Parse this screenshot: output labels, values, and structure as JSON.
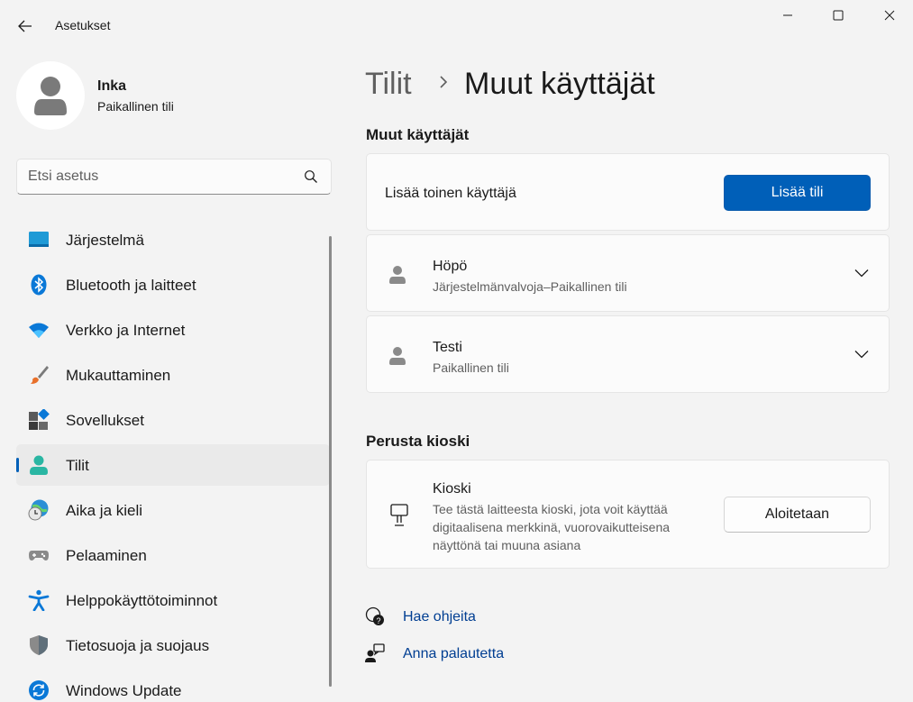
{
  "window": {
    "title": "Asetukset",
    "icons": {
      "back": "back-arrow-icon",
      "minimize": "minimize-icon",
      "maximize": "maximize-icon",
      "close": "close-icon"
    }
  },
  "user": {
    "name": "Inka",
    "account_type": "Paikallinen tili",
    "icon": "user-avatar-icon"
  },
  "search": {
    "placeholder": "Etsi asetus",
    "icon": "search-icon"
  },
  "sidebar": {
    "active_index": 5,
    "accent": "#005fb8",
    "items": [
      {
        "label": "Järjestelmä",
        "icon": "system-icon"
      },
      {
        "label": "Bluetooth ja laitteet",
        "icon": "bluetooth-icon"
      },
      {
        "label": "Verkko ja Internet",
        "icon": "wifi-icon"
      },
      {
        "label": "Mukauttaminen",
        "icon": "brush-icon"
      },
      {
        "label": "Sovellukset",
        "icon": "apps-icon"
      },
      {
        "label": "Tilit",
        "icon": "accounts-icon"
      },
      {
        "label": "Aika ja kieli",
        "icon": "time-language-icon"
      },
      {
        "label": "Pelaaminen",
        "icon": "gaming-icon"
      },
      {
        "label": "Helppokäyttötoiminnot",
        "icon": "accessibility-icon"
      },
      {
        "label": "Tietosuoja ja suojaus",
        "icon": "shield-icon"
      },
      {
        "label": "Windows Update",
        "icon": "update-icon"
      }
    ]
  },
  "breadcrumb": {
    "parent": "Tilit",
    "current": "Muut käyttäjät"
  },
  "other_users": {
    "section_title": "Muut käyttäjät",
    "add_row": {
      "label": "Lisää toinen käyttäjä",
      "button": "Lisää tili"
    },
    "users": [
      {
        "name": "Höpö",
        "detail": "Järjestelmänvalvoja–Paikallinen tili"
      },
      {
        "name": "Testi",
        "detail": "Paikallinen tili"
      }
    ]
  },
  "kiosk": {
    "section_title": "Perusta kioski",
    "title": "Kioski",
    "description": "Tee tästä laitteesta kioski, jota voit käyttää digitaalisena merkkinä, vuorovaikutteisena näyttönä tai muuna asiana",
    "button": "Aloitetaan",
    "icon": "kiosk-icon"
  },
  "help": {
    "get_help": "Hae ohjeita",
    "feedback": "Anna palautetta"
  },
  "colors": {
    "accent": "#005fb8",
    "link": "#003e92",
    "background": "#f3f3f3",
    "card": "#fbfbfb"
  }
}
